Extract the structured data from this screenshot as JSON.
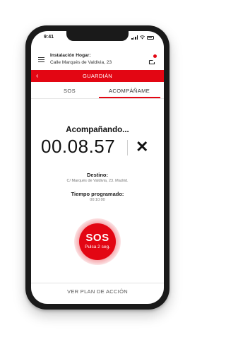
{
  "status_bar": {
    "time": "9:41"
  },
  "header": {
    "title": "Instalación Hogar:",
    "subtitle": "Calle Marqués de Valdivia, 23"
  },
  "nav": {
    "title": "GUARDIÁN"
  },
  "tabs": [
    {
      "label": "SOS",
      "active": false
    },
    {
      "label": "ACOMPÁÑAME",
      "active": true
    }
  ],
  "tracking": {
    "status": "Acompañando...",
    "timer": "00.08.57"
  },
  "destination": {
    "label": "Destino:",
    "value": "C/ Marqués de Valdivia, 23. Madrid."
  },
  "scheduled": {
    "label": "Tiempo programado:",
    "value": "00:10:00"
  },
  "sos": {
    "label": "SOS",
    "hint": "Pulsa 2 seg."
  },
  "footer": {
    "action_label": "VER PLAN DE ACCIÓN"
  },
  "colors": {
    "accent": "#e30613"
  },
  "icons": {
    "menu": "menu-icon",
    "notifications": "notification-icon",
    "back": "chevron-left-icon",
    "close": "close-icon"
  }
}
